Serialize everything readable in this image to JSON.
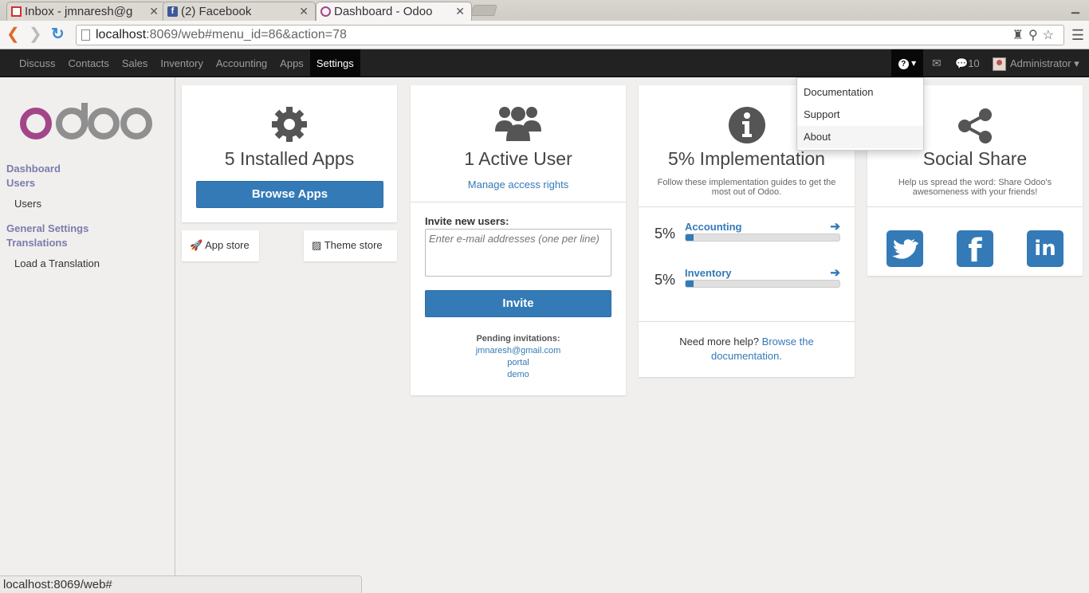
{
  "browser": {
    "tabs": [
      {
        "title": "Inbox - jmnaresh@g",
        "icon": "gmail-icon"
      },
      {
        "title": "(2) Facebook",
        "icon": "facebook-icon"
      },
      {
        "title": "Dashboard - Odoo",
        "icon": "odoo-icon"
      }
    ],
    "url_host": "localhost",
    "url_rest": ":8069/web#menu_id=86&action=78",
    "status_url": "localhost:8069/web#"
  },
  "topbar": {
    "menu": [
      "Discuss",
      "Contacts",
      "Sales",
      "Inventory",
      "Accounting",
      "Apps",
      "Settings"
    ],
    "active_menu": "Settings",
    "chat_count": "10",
    "user": "Administrator"
  },
  "help_menu": {
    "items": [
      "Documentation",
      "Support",
      "About"
    ],
    "hovered": "About"
  },
  "sidebar": {
    "sections": [
      {
        "label": "Dashboard",
        "items": []
      },
      {
        "label": "Users",
        "items": [
          "Users"
        ]
      },
      {
        "label": "General Settings",
        "items": []
      },
      {
        "label": "Translations",
        "items": [
          "Load a Translation"
        ]
      }
    ]
  },
  "apps_card": {
    "title": "5 Installed Apps",
    "button": "Browse Apps",
    "app_store": "App store",
    "theme_store": "Theme store"
  },
  "users_card": {
    "title": "1 Active User",
    "manage_link": "Manage access rights",
    "invite_label": "Invite new users:",
    "invite_placeholder": "Enter e-mail addresses (one per line)",
    "invite_button": "Invite",
    "pending_label": "Pending invitations:",
    "pending": [
      "jmnaresh@gmail.com",
      "portal",
      "demo"
    ]
  },
  "impl_card": {
    "title": "5% Implementation",
    "subtitle": "Follow these implementation guides to get the most out of Odoo.",
    "guides": [
      {
        "pct": "5%",
        "name": "Accounting",
        "progress": 0.05
      },
      {
        "pct": "5%",
        "name": "Inventory",
        "progress": 0.05
      }
    ],
    "help_text": "Need more help?",
    "help_link_1": "Browse the",
    "help_link_2": "documentation."
  },
  "social_card": {
    "title": "Social Share",
    "subtitle": "Help us spread the word: Share Odoo's awesomeness with your friends!",
    "networks": [
      "twitter-icon",
      "facebook-icon",
      "linkedin-icon"
    ]
  },
  "colors": {
    "primary": "#337ab7",
    "odoo_purple": "#a24689",
    "topbar": "#222222",
    "sidebar_section": "#7c7bad"
  }
}
